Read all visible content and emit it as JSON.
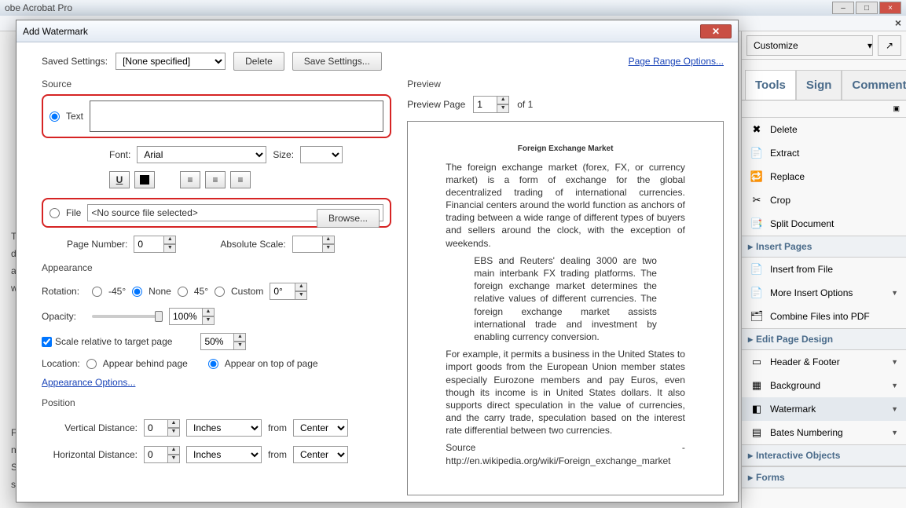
{
  "app": {
    "title": "obe Acrobat Pro"
  },
  "window_controls": {
    "min": "–",
    "max": "□",
    "close": "×",
    "inner_close": "×"
  },
  "customize": {
    "label": "Customize"
  },
  "tabs": {
    "tools": "Tools",
    "sign": "Sign",
    "comment": "Comment"
  },
  "panel": {
    "pages_items": [
      {
        "label": "Delete",
        "icon": "✖",
        "color": "#c33"
      },
      {
        "label": "Extract",
        "icon": "📄"
      },
      {
        "label": "Replace",
        "icon": "🔁"
      },
      {
        "label": "Crop",
        "icon": "✂"
      },
      {
        "label": "Split Document",
        "icon": "📑"
      }
    ],
    "heading_insert": "Insert Pages",
    "insert_items": [
      {
        "label": "Insert from File",
        "icon": "📄"
      },
      {
        "label": "More Insert Options",
        "icon": "📄",
        "caret": true
      },
      {
        "label": "Combine Files into PDF",
        "icon": "🗂"
      }
    ],
    "heading_design": "Edit Page Design",
    "design_items": [
      {
        "label": "Header & Footer",
        "icon": "▭",
        "caret": true
      },
      {
        "label": "Background",
        "icon": "▦",
        "caret": true
      },
      {
        "label": "Watermark",
        "icon": "◧",
        "caret": true,
        "selected": true
      },
      {
        "label": "Bates Numbering",
        "icon": "▤",
        "caret": true
      }
    ],
    "heading_interactive": "Interactive Objects",
    "heading_forms": "Forms"
  },
  "dialog": {
    "title": "Add Watermark",
    "saved_settings_label": "Saved Settings:",
    "saved_settings_value": "[None specified]",
    "delete_btn": "Delete",
    "save_btn": "Save Settings...",
    "page_range_link": "Page Range Options...",
    "source": {
      "label": "Source",
      "text_radio": "Text",
      "text_value": "",
      "font_label": "Font:",
      "font_value": "Arial",
      "size_label": "Size:",
      "size_value": "",
      "file_radio": "File",
      "file_value": "<No source file selected>",
      "browse_btn": "Browse...",
      "page_num_label": "Page Number:",
      "page_num_value": "0",
      "abs_scale_label": "Absolute Scale:",
      "abs_scale_value": ""
    },
    "appearance": {
      "label": "Appearance",
      "rotation_label": "Rotation:",
      "rot_n45": "-45°",
      "rot_none": "None",
      "rot_p45": "45°",
      "rot_custom": "Custom",
      "rot_value": "0°",
      "opacity_label": "Opacity:",
      "opacity_value": "100%",
      "scale_chk": "Scale relative to target page",
      "scale_value": "50%",
      "location_label": "Location:",
      "loc_behind": "Appear behind page",
      "loc_ontop": "Appear on top of page",
      "options_link": "Appearance Options..."
    },
    "position": {
      "label": "Position",
      "vdist_label": "Vertical Distance:",
      "vdist_value": "0",
      "hdist_label": "Horizontal Distance:",
      "hdist_value": "0",
      "unit": "Inches",
      "from": "from",
      "ref": "Center"
    },
    "preview": {
      "label": "Preview",
      "page_label": "Preview Page",
      "page_value": "1",
      "of": "of 1",
      "doc_title": "Foreign Exchange Market"
    }
  },
  "bg_text": {
    "l1": "T",
    "l2": "d",
    "l3": "a",
    "l4": "w",
    "l5": "F",
    "l6": "n",
    "l7": "S",
    "l8": "sp"
  }
}
